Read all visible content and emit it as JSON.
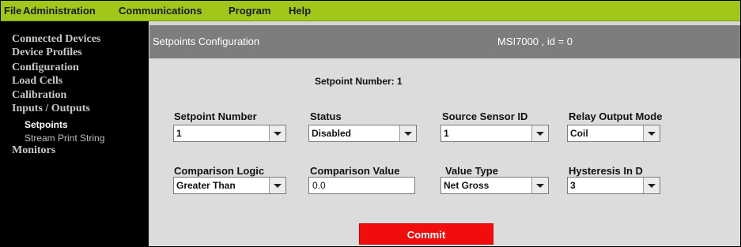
{
  "menubar": [
    "File",
    "Administration",
    "Communications",
    "Program",
    "Help"
  ],
  "sidebar": {
    "items": [
      {
        "label": "Connected Devices"
      },
      {
        "label": "Device Profiles"
      },
      {
        "label": "Configuration"
      },
      {
        "label": "Load Cells"
      },
      {
        "label": "Calibration"
      },
      {
        "label": "Inputs / Outputs"
      },
      {
        "label": "Setpoints"
      },
      {
        "label": "Stream Print String"
      },
      {
        "label": "Monitors"
      }
    ]
  },
  "header": {
    "title": "Setpoints Configuration",
    "device": "MSI7000 , id = 0"
  },
  "form": {
    "setpoint_number_heading": "Setpoint Number: 1",
    "fields": {
      "setpoint_number": {
        "label": "Setpoint Number",
        "value": "1"
      },
      "status": {
        "label": "Status",
        "value": "Disabled"
      },
      "source_sensor_id": {
        "label": "Source Sensor ID",
        "value": "1"
      },
      "relay_output_mode": {
        "label": "Relay Output Mode",
        "value": "Coil"
      },
      "comparison_logic": {
        "label": "Comparison Logic",
        "value": "Greater Than"
      },
      "comparison_value": {
        "label": "Comparison Value",
        "value": "0.0"
      },
      "value_type": {
        "label": "Value Type",
        "value": "Net Gross"
      },
      "hysteresis": {
        "label": "Hysteresis In D",
        "value": "3"
      }
    },
    "commit_label": "Commit"
  },
  "colors": {
    "menubar": "#a0c71a",
    "sidebar": "#000000",
    "header": "#7d7d7d",
    "commit": "#f20c0c"
  }
}
